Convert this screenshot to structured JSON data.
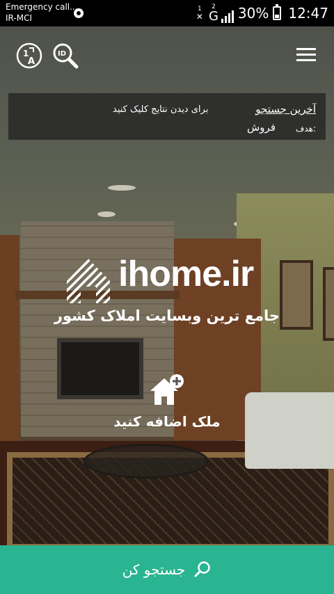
{
  "status_bar": {
    "carrier_line1": "Emergency call...",
    "carrier_line2": "IR-MCI",
    "sim1_label": "1",
    "sim2_label": "2",
    "network_type": "G",
    "battery_percent": "30%",
    "battery_level": 0.3,
    "time": "12:47"
  },
  "header": {
    "translate_icon": "translate-icon",
    "id_search_icon": "id-search-icon",
    "menu_icon": "hamburger-menu-icon"
  },
  "last_search": {
    "title": "آخرین جستجو",
    "hint": "برای دیدن نتایج کلیک کنید",
    "goal_label": "هدف:",
    "goal_value": "فروش"
  },
  "logo": {
    "brand": "ihome.ir",
    "tagline": "جامع ترین وبسایت املاک کشور"
  },
  "add_property": {
    "label": "ملک اضافه کنید",
    "icon": "add-home-icon"
  },
  "search_button": {
    "label": "جستجو کن",
    "icon": "search-icon"
  },
  "colors": {
    "accent": "#2ab491",
    "panel": "#282828"
  }
}
